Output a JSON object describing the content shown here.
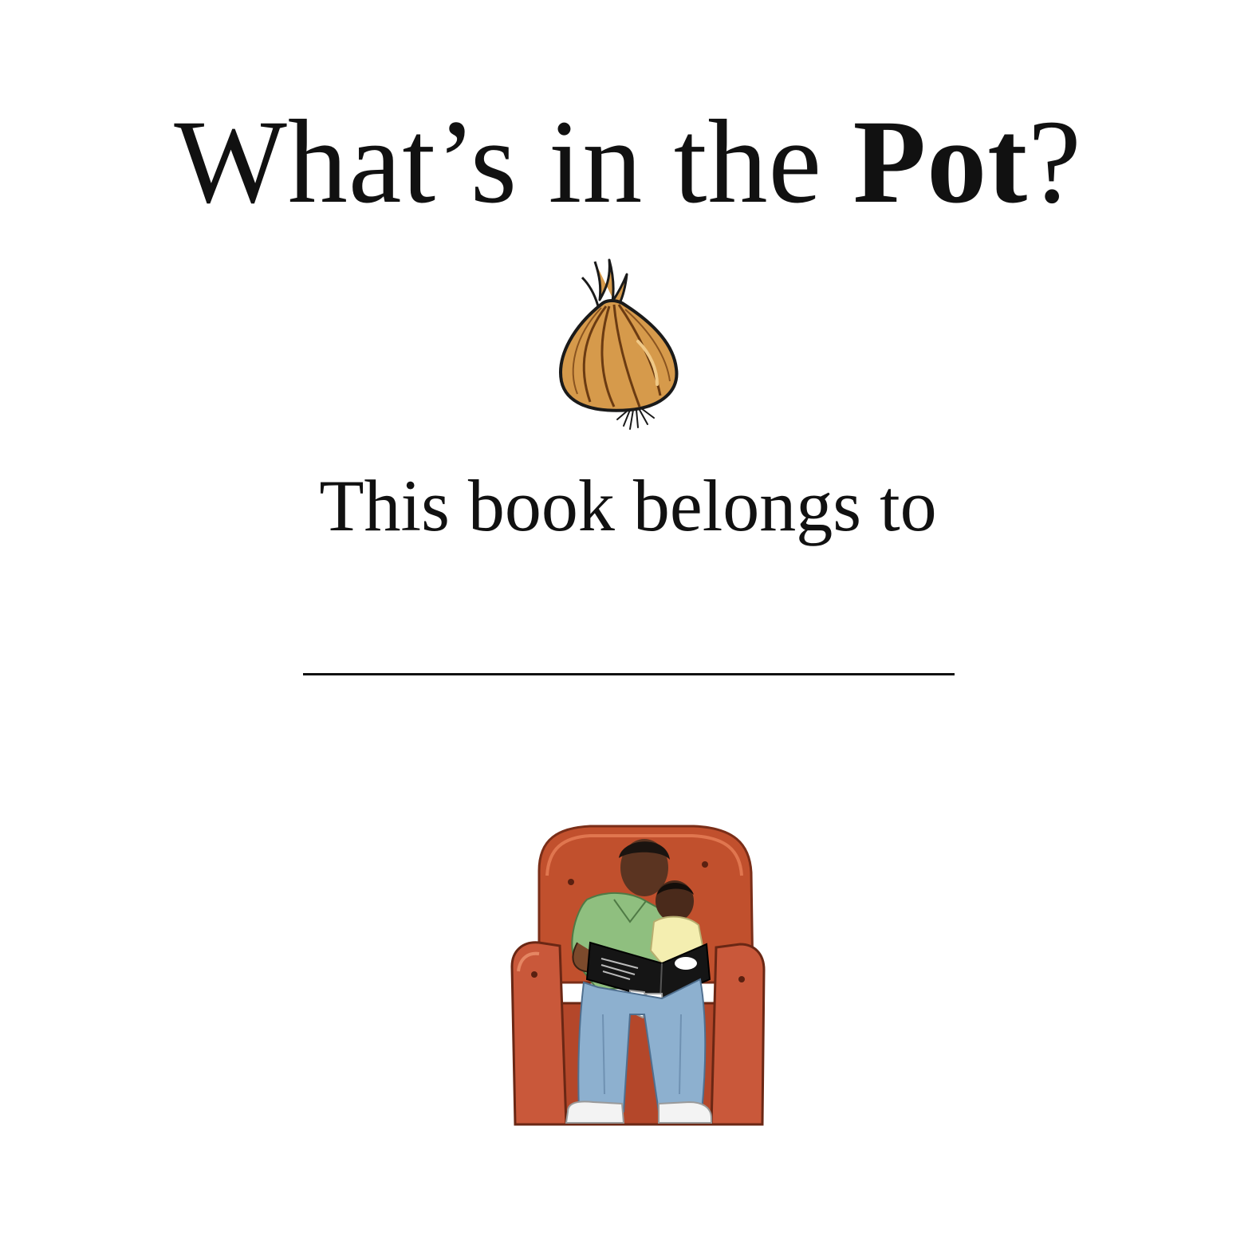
{
  "title": {
    "part1": "What’s in the ",
    "part2_bold": "Pot",
    "part3": "?"
  },
  "belongs_to": "This book belongs to",
  "illustrations": {
    "top": "onion-illustration",
    "bottom": "father-child-reading-illustration"
  },
  "colors": {
    "text": "#111111",
    "onion_fill": "#d69a4b",
    "chair": "#c1502d",
    "shirt": "#8fbf7f",
    "jeans": "#8db0cf"
  }
}
